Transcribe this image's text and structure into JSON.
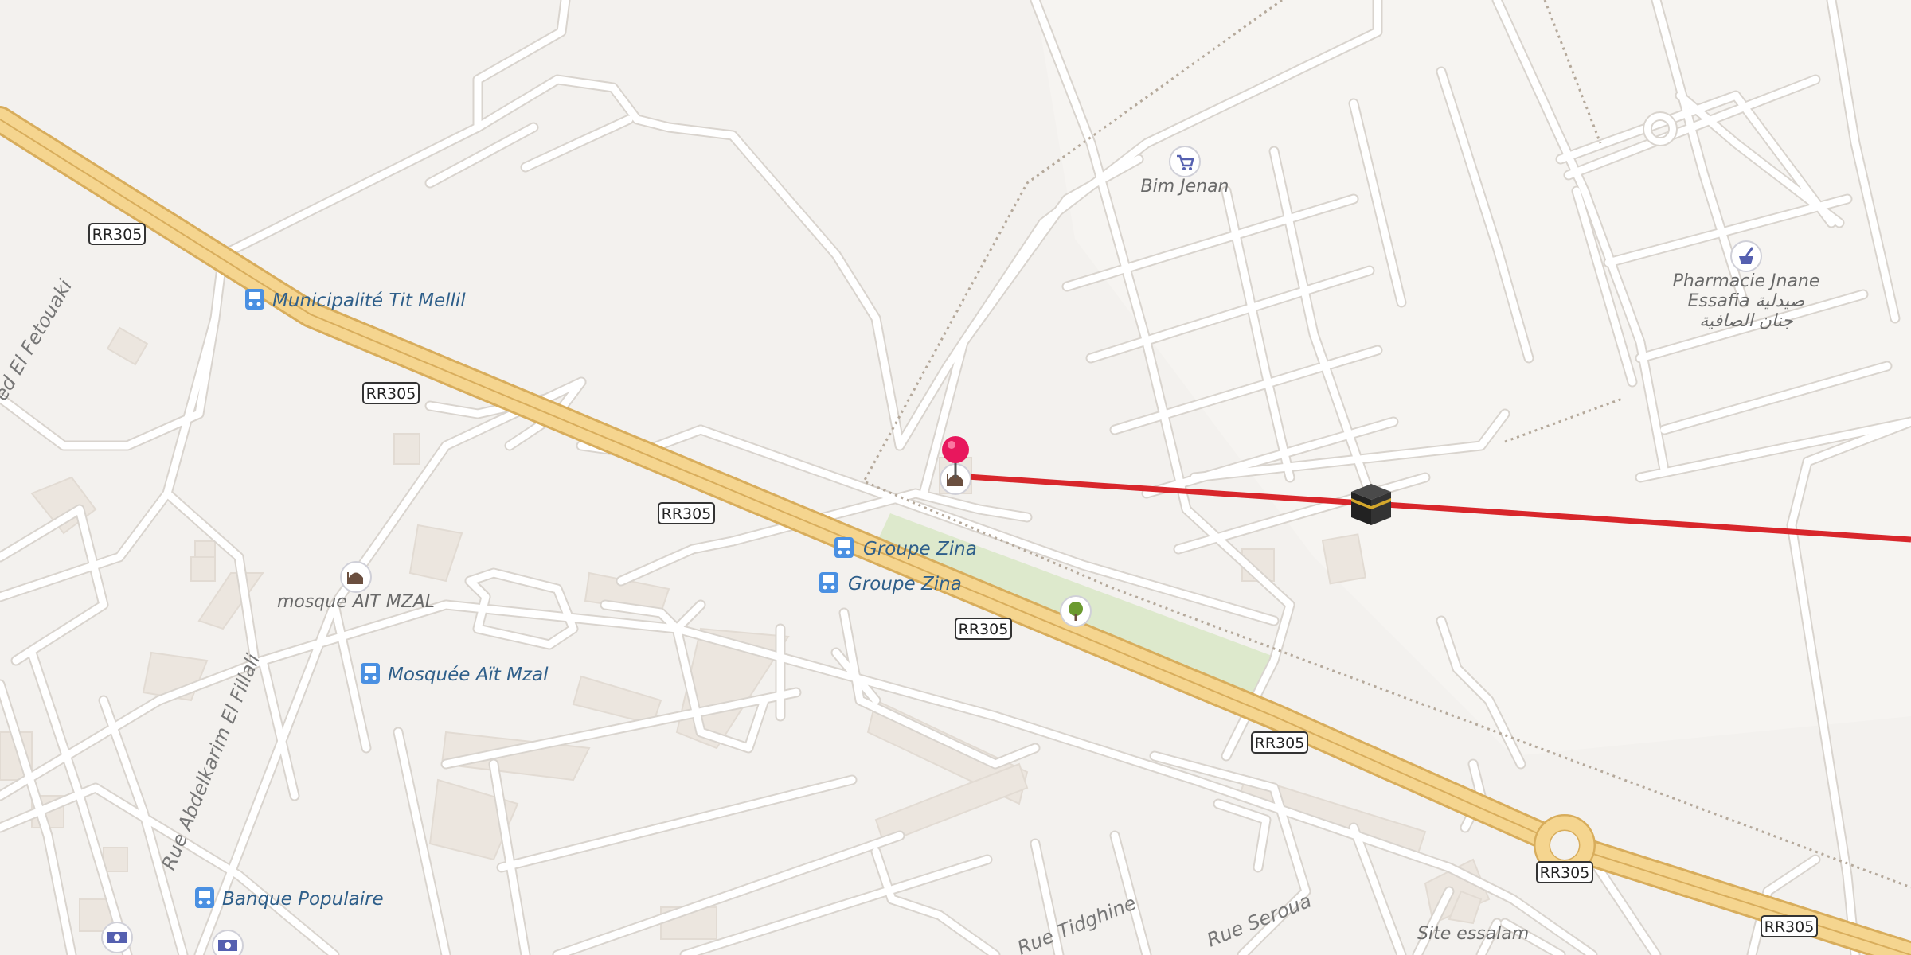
{
  "road_shields": {
    "rr305": "RR305"
  },
  "bus_stops": {
    "municipalite": "Municipalité Tit Mellil",
    "groupe_zina_1": "Groupe Zina",
    "groupe_zina_2": "Groupe Zina",
    "mosquee_ait_mzal": "Mosquée Aït Mzal",
    "banque_populaire": "Banque Populaire"
  },
  "pois": {
    "bim_jenan": "Bim Jenan",
    "pharmacie_line1": "Pharmacie Jnane",
    "pharmacie_line2": "Essafia صيدلية",
    "pharmacie_line3": "جنان الصافية",
    "mosque_ait_mzal": "mosque AIT MZAL",
    "site_essalam": "Site essalam"
  },
  "streets": {
    "fetouaki": "ed El Fetouaki",
    "fillali": "Rue Abdelkarim El Fillali",
    "tidghine": "Rue Tidghine",
    "seroua": "Rue Seroua"
  },
  "icons": {
    "pin": "location-pin-icon",
    "kaaba": "kaaba-icon",
    "qibla_line_color": "#d8262b",
    "pin_color": "#e8175d",
    "bus_color": "#4a90e2",
    "road_color": "#f5d58f"
  }
}
